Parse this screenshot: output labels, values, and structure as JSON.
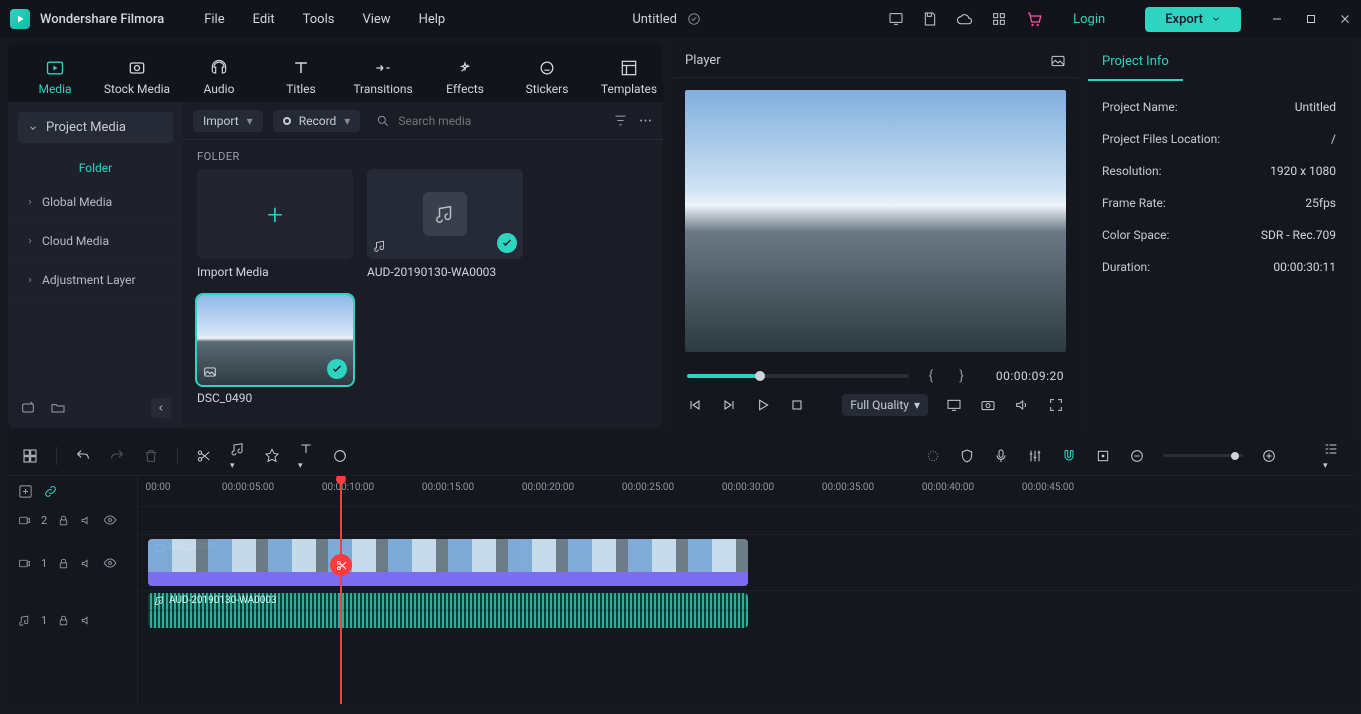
{
  "app": {
    "name": "Wondershare Filmora",
    "menus": [
      "File",
      "Edit",
      "Tools",
      "View",
      "Help"
    ],
    "doc_title": "Untitled",
    "login": "Login",
    "export": "Export"
  },
  "tabs": {
    "items": [
      "Media",
      "Stock Media",
      "Audio",
      "Titles",
      "Transitions",
      "Effects",
      "Stickers",
      "Templates"
    ]
  },
  "sidebar": {
    "project_media": "Project Media",
    "folder": "Folder",
    "items": [
      "Global Media",
      "Cloud Media",
      "Adjustment Layer"
    ]
  },
  "media": {
    "import": "Import",
    "record": "Record",
    "search_placeholder": "Search media",
    "folder_label": "FOLDER",
    "cards": {
      "import_media": "Import Media",
      "aud": "AUD-20190130-WA0003",
      "dsc": "DSC_0490"
    }
  },
  "player": {
    "title": "Player",
    "timecode": "00:00:09:20",
    "quality": "Full Quality"
  },
  "info": {
    "tab": "Project Info",
    "rows": [
      {
        "k": "Project Name:",
        "v": "Untitled"
      },
      {
        "k": "Project Files Location:",
        "v": "/"
      },
      {
        "k": "Resolution:",
        "v": "1920 x 1080"
      },
      {
        "k": "Frame Rate:",
        "v": "25fps"
      },
      {
        "k": "Color Space:",
        "v": "SDR - Rec.709"
      },
      {
        "k": "Duration:",
        "v": "00:00:30:11"
      }
    ]
  },
  "timeline": {
    "ticks": [
      "00:00",
      "00:00:05:00",
      "00:00:10:00",
      "00:00:15:00",
      "00:00:20:00",
      "00:00:25:00",
      "00:00:30:00",
      "00:00:35:00",
      "00:00:40:00",
      "00:00:45:00"
    ],
    "tracks": {
      "t2": "2",
      "t1v": "1",
      "t1a": "1"
    },
    "clips": {
      "video": "DSC_0490",
      "audio": "AUD-20190130-WA0003"
    }
  }
}
